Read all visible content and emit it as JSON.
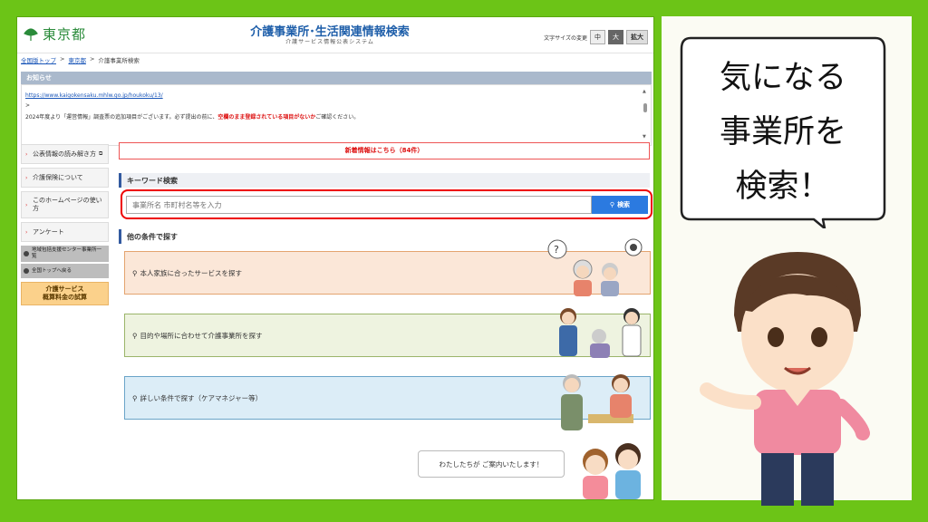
{
  "header": {
    "logo_text": "東京都",
    "title": "介護事業所･生活関連情報検索",
    "subtitle": "介護サービス情報公表システム",
    "font_size_label": "文字サイズの変更",
    "font_size_options": [
      "中",
      "大",
      "拡大"
    ]
  },
  "breadcrumb": [
    "全国版トップ",
    ">",
    "東京都",
    ">",
    "介護事業所検索"
  ],
  "notice": {
    "title": "お知らせ",
    "link": "https://www.kaigokensaku.mhlw.go.jp/houkoku/13/",
    "gt": ">",
    "line_prefix": "2024年度より「運営情報」調査票の追加項目がございます。必ず提出の前に、",
    "line_red": "空欄のまま登録されている項目がないか",
    "line_suffix": "ご確認ください。"
  },
  "sidebar": {
    "items": [
      "公表情報の読み解き方",
      "介護保険について",
      "このホームページの使い方",
      "アンケート"
    ],
    "gray_items": [
      "地域包括支援センター事業所一覧",
      "全国トップへ戻る"
    ],
    "orange": "介護サービス\n概算料金の試算"
  },
  "whatsnew": "新着情報はこちら（84件）",
  "keyword": {
    "heading": "キーワード検索",
    "placeholder": "事業所名 市町村名等を入力",
    "button": "検索"
  },
  "other": {
    "heading": "他の条件で探す",
    "cat1": "本人家族に合ったサービスを探す",
    "cat2": "目的や場所に合わせて介護事業所を探す",
    "cat3": "詳しい条件で探す（ケアマネジャー等）"
  },
  "guide": "わたしたちが ご案内いたします！",
  "bubble": [
    "気になる",
    "事業所を",
    "検索！"
  ],
  "colors": {
    "background": "#6cc417",
    "accent": "#2b7ae0",
    "highlight": "#e00000"
  }
}
